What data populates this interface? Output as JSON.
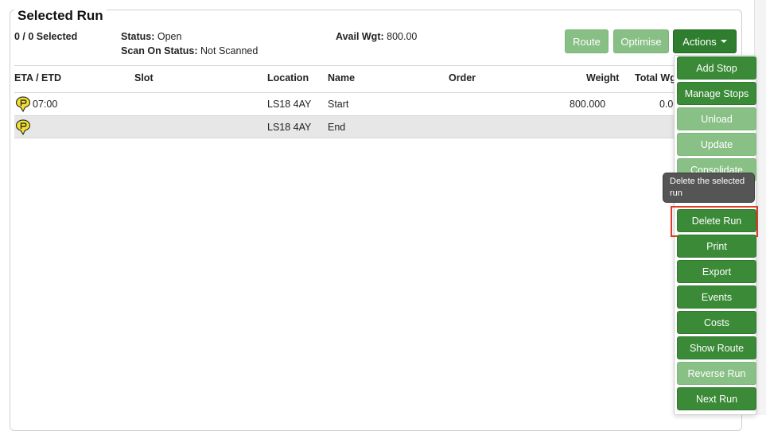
{
  "panel": {
    "title": "Selected Run",
    "selected_count": "0 / 0 Selected",
    "status_label": "Status:",
    "status_value": "Open",
    "scan_label": "Scan On Status:",
    "scan_value": "Not Scanned",
    "avail_label": "Avail Wgt:",
    "avail_value": "800.00"
  },
  "toolbar": {
    "route_label": "Route",
    "optimise_label": "Optimise",
    "actions_label": "Actions"
  },
  "table": {
    "headers": {
      "eta": "ETA / ETD",
      "slot": "Slot",
      "location": "Location",
      "name": "Name",
      "order": "Order",
      "weight": "Weight",
      "total": "Total Wg"
    },
    "rows": [
      {
        "eta": "07:00",
        "slot": "",
        "location": "LS18 4AY",
        "name": "Start",
        "order": "",
        "weight": "800.000",
        "total": "0.00"
      },
      {
        "eta": "",
        "slot": "",
        "location": "LS18 4AY",
        "name": "End",
        "order": "",
        "weight": "",
        "total": ""
      }
    ]
  },
  "actions_menu": {
    "items": [
      {
        "label": "Add Stop",
        "style": "dark"
      },
      {
        "label": "Manage Stops",
        "style": "dark"
      },
      {
        "label": "Unload",
        "style": "pale"
      },
      {
        "label": "Update",
        "style": "pale"
      },
      {
        "label": "Consolidate",
        "style": "pale"
      },
      {
        "label": "Delete Run",
        "style": "dark"
      },
      {
        "label": "Print",
        "style": "dark"
      },
      {
        "label": "Export",
        "style": "dark"
      },
      {
        "label": "Events",
        "style": "dark"
      },
      {
        "label": "Costs",
        "style": "dark"
      },
      {
        "label": "Show Route",
        "style": "dark"
      },
      {
        "label": "Reverse Run",
        "style": "pale"
      },
      {
        "label": "Next Run",
        "style": "dark"
      }
    ],
    "tooltip": "Delete the selected run"
  },
  "colors": {
    "button_dark": "#2f7d2f",
    "button_pale": "#87bf84",
    "highlight": "#e03a2c",
    "pin_fill": "#f5e22a"
  },
  "icons": {
    "stop_pin": "map-pin-icon"
  }
}
